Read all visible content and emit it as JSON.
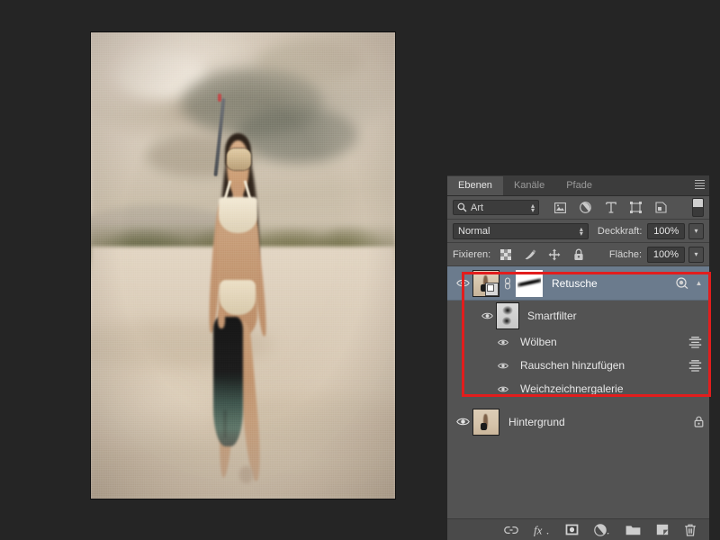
{
  "panel": {
    "tabs": [
      {
        "label": "Ebenen",
        "active": true
      },
      {
        "label": "Kanäle",
        "active": false
      },
      {
        "label": "Pfade",
        "active": false
      }
    ],
    "menu_icon": "panel-menu-icon",
    "filter": {
      "search_icon": "search-icon",
      "label": "Art",
      "icons": [
        "pixel-layers-filter-icon",
        "adjustment-layers-filter-icon",
        "type-layers-filter-icon",
        "shape-layers-filter-icon",
        "smart-object-filter-icon"
      ],
      "toggle_icon": "filter-toggle-switch"
    },
    "blend": {
      "mode": "Normal",
      "opacity_label": "Deckkraft:",
      "opacity_value": "100%",
      "fill_label": "Fläche:",
      "fill_value": "100%"
    },
    "lock": {
      "label": "Fixieren:",
      "icons": [
        "lock-transparent-pixels-icon",
        "lock-image-pixels-icon",
        "lock-position-icon",
        "lock-all-icon"
      ]
    },
    "layers": [
      {
        "name": "Retusche",
        "selected": true,
        "visible": true,
        "has_mask": true,
        "linked": true,
        "smart_object": true,
        "right_icon": "layer-effects-visibility-icon",
        "scroll_icon": "scroll-up-arrow"
      },
      {
        "name": "Hintergrund",
        "selected": false,
        "visible": true,
        "locked": true,
        "lock_icon": "lock-icon"
      }
    ],
    "smart_filters": {
      "group_name": "Smartfilter",
      "visible": true,
      "items": [
        {
          "name": "Wölben",
          "visible": true,
          "settings_icon": "filter-settings-icon"
        },
        {
          "name": "Rauschen hinzufügen",
          "visible": true,
          "settings_icon": "filter-settings-icon"
        },
        {
          "name": "Weichzeichnergalerie",
          "visible": true,
          "settings_icon": null
        }
      ]
    },
    "bottom_toolbar": [
      {
        "icon": "link-layers-icon"
      },
      {
        "icon": "layer-style-fx-icon"
      },
      {
        "icon": "add-layer-mask-icon"
      },
      {
        "icon": "new-adjustment-layer-icon"
      },
      {
        "icon": "new-group-icon"
      },
      {
        "icon": "new-layer-icon"
      },
      {
        "icon": "delete-layer-icon"
      }
    ]
  },
  "annotation": {
    "highlight_color": "#e21d1d",
    "name": "red-highlight-rectangle"
  },
  "canvas": {
    "document_name": "beach-snorkel-photo"
  },
  "colors": {
    "app_background": "#252525",
    "panel_background": "#535353",
    "panel_header": "#3c3c3c",
    "selected_layer": "#6b7b8d",
    "accent_red": "#e21d1d"
  }
}
